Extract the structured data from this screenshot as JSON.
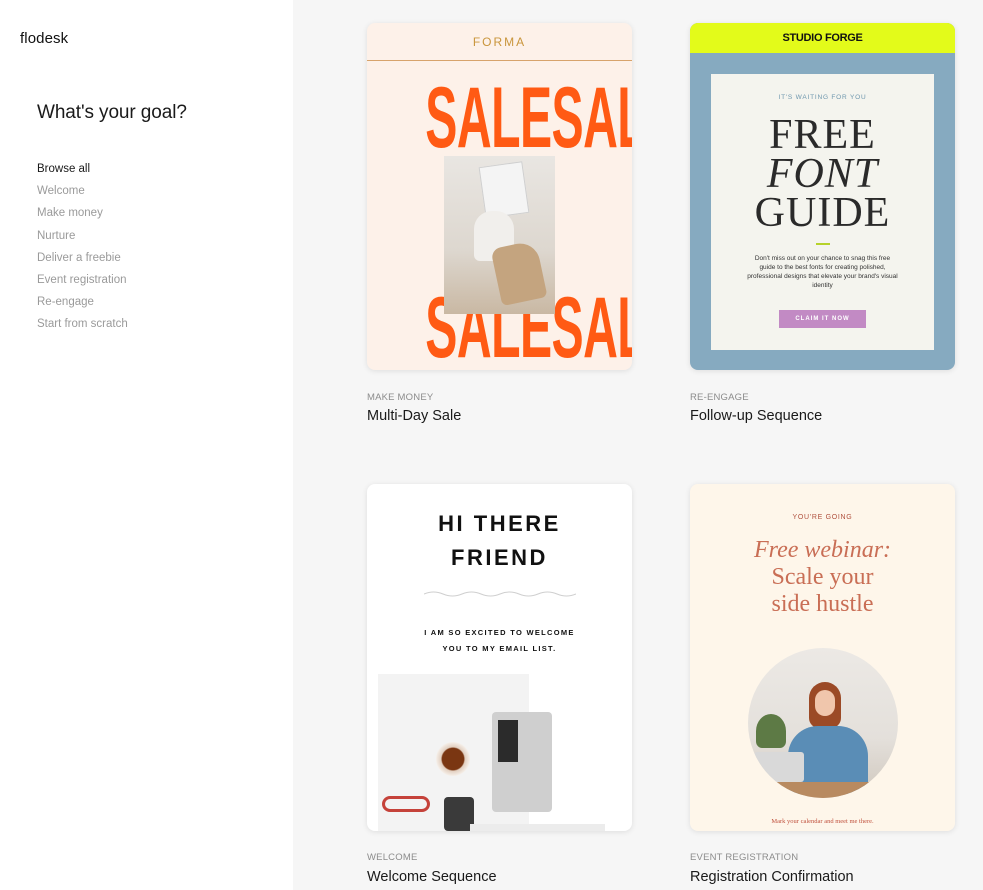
{
  "app": {
    "logo": "flodesk"
  },
  "sidebar": {
    "title": "What's your goal?",
    "items": [
      {
        "label": "Browse all",
        "active": true
      },
      {
        "label": "Welcome",
        "active": false
      },
      {
        "label": "Make money",
        "active": false
      },
      {
        "label": "Nurture",
        "active": false
      },
      {
        "label": "Deliver a freebie",
        "active": false
      },
      {
        "label": "Event registration",
        "active": false
      },
      {
        "label": "Re-engage",
        "active": false
      },
      {
        "label": "Start from scratch",
        "active": false
      }
    ]
  },
  "templates": [
    {
      "category": "MAKE MONEY",
      "title": "Multi-Day Sale",
      "preview": {
        "brand": "FORMA",
        "sale_word": "SALESALE",
        "accent": "#ff5a14"
      }
    },
    {
      "category": "RE-ENGAGE",
      "title": "Follow-up Sequence",
      "preview": {
        "brand": "STUDIO FORGE",
        "kicker": "IT'S WAITING FOR YOU",
        "headline_1": "FREE",
        "headline_2": "FONT",
        "headline_3": "GUIDE",
        "body": "Don't miss out on your chance to snag this free guide to the best fonts for creating polished, professional designs that elevate your brand's visual identity",
        "cta": "CLAIM IT NOW"
      }
    },
    {
      "category": "WELCOME",
      "title": "Welcome Sequence",
      "preview": {
        "headline_1": "HI THERE",
        "headline_2": "FRIEND",
        "sub_1": "I AM SO EXCITED TO WELCOME",
        "sub_2": "YOU TO MY EMAIL LIST."
      }
    },
    {
      "category": "EVENT REGISTRATION",
      "title": "Registration Confirmation",
      "preview": {
        "kicker": "YOU'RE GOING",
        "headline_1": "Free webinar:",
        "headline_2": "Scale your",
        "headline_3": "side hustle",
        "footer": "Mark your calendar and meet me there."
      }
    }
  ]
}
